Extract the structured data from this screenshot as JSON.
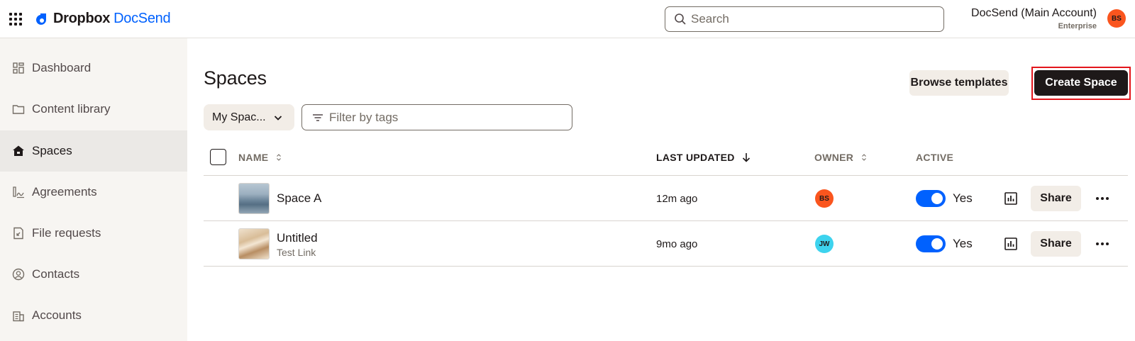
{
  "brand": {
    "name": "Dropbox",
    "product": "DocSend"
  },
  "search": {
    "placeholder": "Search"
  },
  "account": {
    "name": "DocSend (Main Account)",
    "plan": "Enterprise",
    "initials": "BS",
    "avatar_color": "#fa551e"
  },
  "sidebar": {
    "items": [
      {
        "label": "Dashboard",
        "icon": "dashboard-icon",
        "active": false
      },
      {
        "label": "Content library",
        "icon": "folder-icon",
        "active": false
      },
      {
        "label": "Spaces",
        "icon": "spaces-icon",
        "active": true
      },
      {
        "label": "Agreements",
        "icon": "signature-icon",
        "active": false
      },
      {
        "label": "File requests",
        "icon": "file-request-icon",
        "active": false
      },
      {
        "label": "Contacts",
        "icon": "contact-icon",
        "active": false
      },
      {
        "label": "Accounts",
        "icon": "accounts-icon",
        "active": false
      }
    ]
  },
  "main": {
    "title": "Spaces",
    "browse_templates_label": "Browse templates",
    "create_space_label": "Create Space",
    "owner_filter_value": "My Spac...",
    "tag_filter_placeholder": "Filter by tags"
  },
  "table": {
    "columns": {
      "name": "NAME",
      "last_updated": "LAST UPDATED",
      "owner": "OWNER",
      "active": "ACTIVE"
    },
    "rows": [
      {
        "name": "Space A",
        "subtitle": "",
        "thumbnail": "mountains",
        "updated": "12m ago",
        "owner_initials": "BS",
        "owner_color": "#fa551e",
        "active": true,
        "active_label": "Yes",
        "share_label": "Share"
      },
      {
        "name": "Untitled",
        "subtitle": "Test Link",
        "thumbnail": "paper",
        "updated": "9mo ago",
        "owner_initials": "JW",
        "owner_color": "#3dd3ee",
        "active": true,
        "active_label": "Yes",
        "share_label": "Share"
      }
    ]
  },
  "colors": {
    "accent": "#0061fe",
    "primary_button": "#1e1919",
    "highlight_frame": "#e3161c"
  }
}
